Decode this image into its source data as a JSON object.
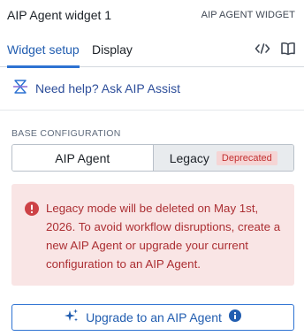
{
  "header": {
    "title": "AIP Agent widget 1",
    "type_label": "AIP AGENT WIDGET"
  },
  "tabs": [
    {
      "label": "Widget setup",
      "active": true
    },
    {
      "label": "Display",
      "active": false
    }
  ],
  "tab_icons": [
    "code-icon",
    "book-icon"
  ],
  "help": {
    "label": "Need help? Ask AIP Assist",
    "icon": "aip-assist-icon"
  },
  "base_configuration": {
    "section_label": "BASE CONFIGURATION",
    "options": [
      {
        "label": "AIP Agent",
        "selected": false
      },
      {
        "label": "Legacy",
        "selected": true,
        "badge": "Deprecated"
      }
    ]
  },
  "callout": {
    "icon": "error-icon",
    "message": "Legacy mode will be deleted on May 1st, 2026. To avoid workflow disruptions, create a new AIP Agent or upgrade your current configuration to an AIP Agent."
  },
  "upgrade_button": {
    "label": "Upgrade to an AIP Agent",
    "icon": "sparkle-icon",
    "info_icon": "info-icon"
  },
  "colors": {
    "accent": "#2d72d2",
    "danger_text": "#ac2f33",
    "danger_bg": "#f9e5e5",
    "badge_bg": "#f5d5d5"
  }
}
